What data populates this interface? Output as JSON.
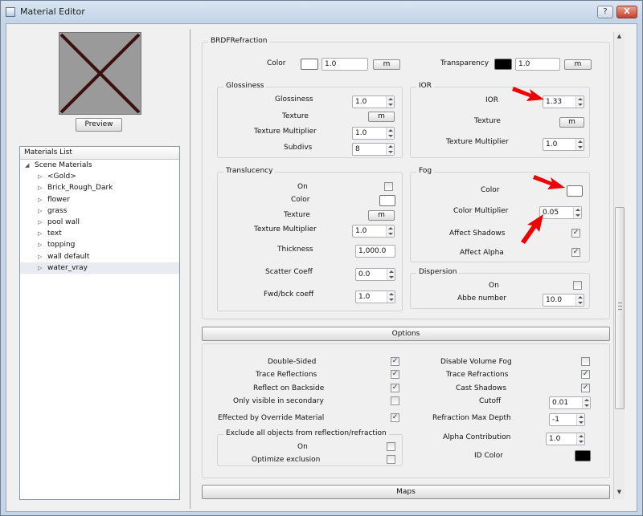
{
  "window": {
    "title": "Material Editor",
    "help_label": "?",
    "close_label": "X"
  },
  "left": {
    "preview_button": "Preview",
    "list_header": "Materials List",
    "root": "Scene Materials",
    "materials": [
      "<Gold>",
      "Brick_Rough_Dark",
      "flower",
      "grass",
      "pool wall",
      "text",
      "topping",
      "wall default",
      "water_vray"
    ],
    "selected": "water_vray"
  },
  "brdf": {
    "title": "BRDFRefraction",
    "color_label": "Color",
    "color_value": "1.0",
    "color_swatch": "#ffffff",
    "color_map": "m",
    "transparency_label": "Transparency",
    "transparency_value": "1.0",
    "transparency_swatch": "#000000",
    "transparency_map": "m",
    "glossiness": {
      "title": "Glossiness",
      "glossiness_label": "Glossiness",
      "glossiness_value": "1.0",
      "texture_label": "Texture",
      "texture_map": "m",
      "multiplier_label": "Texture Multiplier",
      "multiplier_value": "1.0",
      "subdivs_label": "Subdivs",
      "subdivs_value": "8"
    },
    "ior": {
      "title": "IOR",
      "ior_label": "IOR",
      "ior_value": "1.33",
      "texture_label": "Texture",
      "texture_map": "m",
      "multiplier_label": "Texture Multiplier",
      "multiplier_value": "1.0"
    },
    "translucency": {
      "title": "Translucency",
      "on_label": "On",
      "on_checked": false,
      "color_label": "Color",
      "color_swatch": "#ffffff",
      "texture_label": "Texture",
      "texture_map": "m",
      "multiplier_label": "Texture Multiplier",
      "multiplier_value": "1.0",
      "thickness_label": "Thickness",
      "thickness_value": "1,000.0",
      "scatter_label": "Scatter Coeff",
      "scatter_value": "0.0",
      "fwdbck_label": "Fwd/bck coeff",
      "fwdbck_value": "1.0"
    },
    "fog": {
      "title": "Fog",
      "color_label": "Color",
      "color_swatch": "#ffffff",
      "multiplier_label": "Color Multiplier",
      "multiplier_value": "0.05",
      "affect_shadows_label": "Affect Shadows",
      "affect_shadows_checked": true,
      "affect_alpha_label": "Affect Alpha",
      "affect_alpha_checked": true
    },
    "dispersion": {
      "title": "Dispersion",
      "on_label": "On",
      "on_checked": false,
      "abbe_label": "Abbe number",
      "abbe_value": "10.0"
    }
  },
  "options": {
    "title": "Options",
    "double_sided_label": "Double-Sided",
    "double_sided_checked": true,
    "trace_reflections_label": "Trace Reflections",
    "trace_reflections_checked": true,
    "reflect_backside_label": "Reflect on Backside",
    "reflect_backside_checked": true,
    "only_visible_label": "Only visible in secondary",
    "only_visible_checked": false,
    "override_label": "Effected by Override Material",
    "override_checked": true,
    "exclude": {
      "title": "Exclude all objects from reflection/refraction",
      "on_label": "On",
      "on_checked": false,
      "optimize_label": "Optimize exclusion",
      "optimize_checked": false
    },
    "disable_fog_label": "Disable Volume Fog",
    "disable_fog_checked": false,
    "trace_refractions_label": "Trace Refractions",
    "trace_refractions_checked": true,
    "cast_shadows_label": "Cast Shadows",
    "cast_shadows_checked": true,
    "cutoff_label": "Cutoff",
    "cutoff_value": "0.01",
    "max_depth_label": "Refraction Max Depth",
    "max_depth_value": "-1",
    "alpha_label": "Alpha Contribution",
    "alpha_value": "1.0",
    "id_color_label": "ID Color",
    "id_color_swatch": "#000000"
  },
  "maps": {
    "title": "Maps"
  },
  "check_glyph": "✓",
  "scroll": {
    "up": "▲",
    "down": "▼"
  }
}
